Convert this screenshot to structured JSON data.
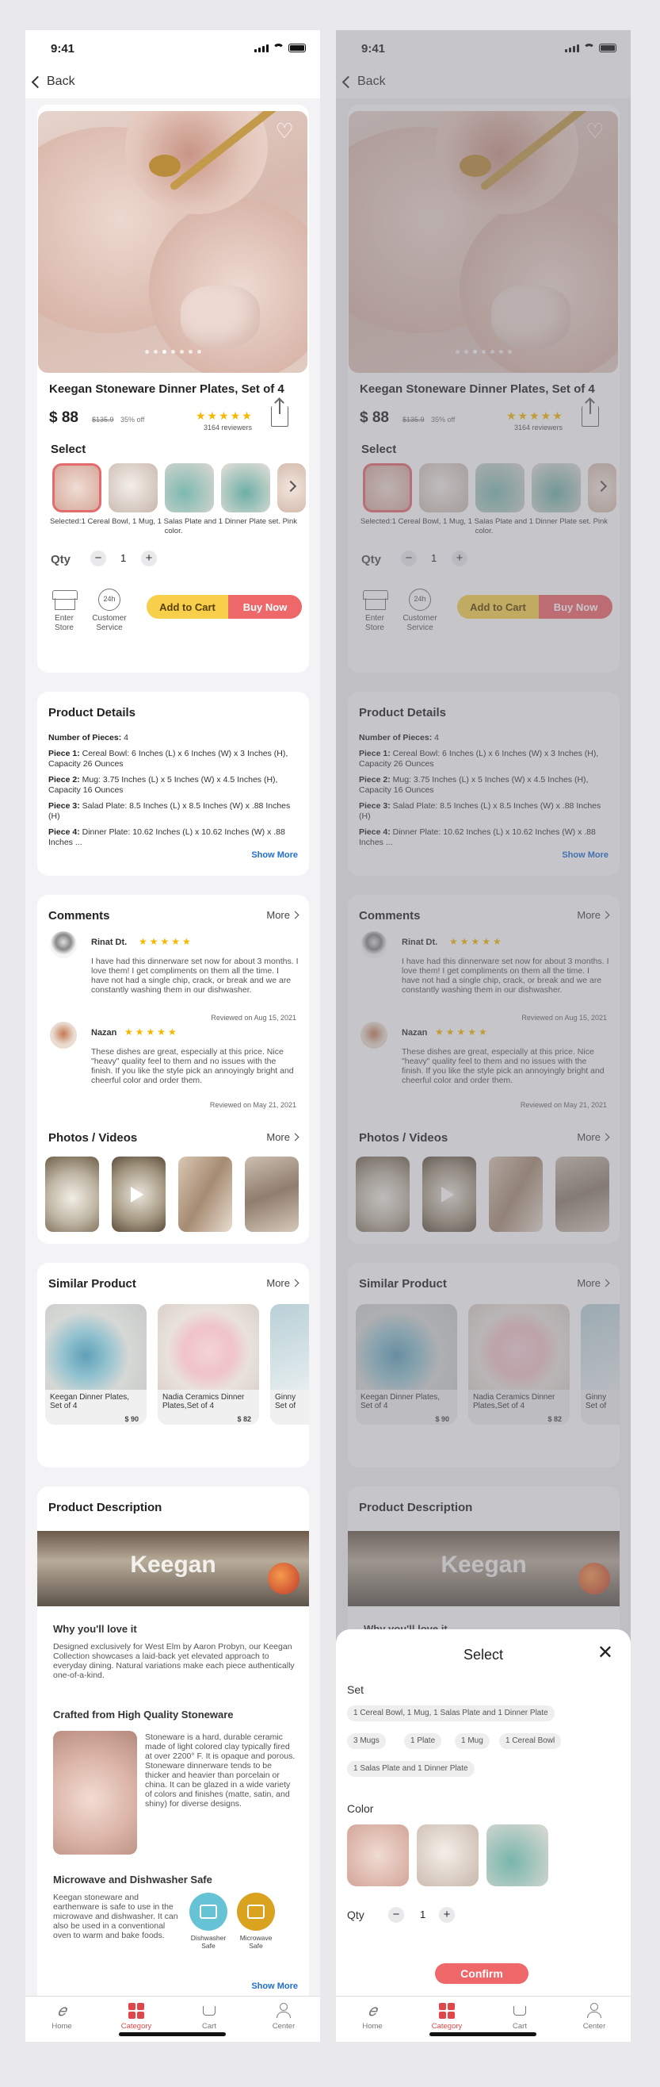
{
  "status": {
    "time": "9:41"
  },
  "nav": {
    "back_label": "Back"
  },
  "product": {
    "title": "Keegan Stoneware Dinner Plates, Set of 4",
    "price": "$ 88",
    "old_price": "$135.9",
    "discount": "35% off",
    "rating": 5,
    "stars": "★★★★★",
    "reviewers": "3164 reviewers",
    "select_label": "Select",
    "selected_note": "Selected:1 Cereal Bowl, 1 Mug, 1 Salas Plate and 1 Dinner Plate set. Pink color.",
    "qty_label": "Qty",
    "qty_value": "1",
    "minus": "−",
    "plus": "+",
    "enter_store": "Enter Store",
    "customer_service": "Customer Service",
    "service_icon_text": "24h",
    "add_to_cart": "Add to Cart",
    "buy_now": "Buy Now"
  },
  "details": {
    "title": "Product Details",
    "pieces_label": "Number of Pieces:",
    "pieces_value": " 4",
    "items": [
      {
        "label": "Piece 1:",
        "text": " Cereal Bowl: 6 Inches (L) x 6 Inches (W) x 3 Inches (H), Capacity 26 Ounces"
      },
      {
        "label": "Piece 2:",
        "text": " Mug: 3.75 Inches (L) x 5 Inches (W) x 4.5 Inches (H), Capacity 16 Ounces"
      },
      {
        "label": "Piece 3:",
        "text": "  Salad Plate: 8.5 Inches (L) x 8.5 Inches (W) x .88 Inches (H)"
      },
      {
        "label": "Piece 4:",
        "text": "  Dinner Plate: 10.62 Inches (L) x 10.62 Inches (W) x .88 Inches ..."
      }
    ],
    "show_more": "Show More"
  },
  "comments": {
    "title": "Comments",
    "more": "More",
    "items": [
      {
        "name": "Rinat Dt.",
        "stars": "★★★★★",
        "text": "I have had this dinnerware set now for about 3 months. I love them! I get compliments on them all the time. I have not had a single chip, crack, or break and we are constantly washing them in our dishwasher.",
        "date": "Reviewed on Aug 15, 2021"
      },
      {
        "name": "Nazan",
        "stars": "★★★★★",
        "text": "These dishes are great, especially at this price. Nice \"heavy\" quality feel to them and no issues with the finish. If you like the style pick an annoyingly bright and cheerful color and order them.",
        "date": "Reviewed on May 21, 2021"
      }
    ]
  },
  "media": {
    "title": "Photos / Videos",
    "more": "More"
  },
  "similar": {
    "title": "Similar Product",
    "more": "More",
    "items": [
      {
        "name": "Keegan Dinner Plates, Set of 4",
        "price": "$ 90"
      },
      {
        "name": "Nadia Ceramics Dinner Plates,Set of 4",
        "price": "$ 82"
      },
      {
        "name": "Ginny Set of",
        "price": ""
      }
    ]
  },
  "description": {
    "title": "Product Description",
    "banner_text": "Keegan",
    "why_title": "Why you'll love it",
    "why_text": "Designed exclusively for West Elm by Aaron Probyn, our Keegan Collection showcases a laid-back yet elevated approach to everyday dining. Natural variations make each piece authentically one-of-a-kind.",
    "crafted_title": "Crafted from High Quality Stoneware",
    "crafted_text": "Stoneware is a hard, durable ceramic made of light colored clay typically fired at over 2200° F. It is opaque and porous. Stoneware dinnerware tends to be thicker and heavier than porcelain or china. It can be glazed in a wide variety of colors and finishes (matte, satin, and shiny) for diverse designs.",
    "safe_title": "Microwave and Dishwasher Safe",
    "safe_text": "Keegan stoneware and earthenware is safe to use in the microwave and dishwasher. It can also be used in a conventional oven to warm and bake foods.",
    "dishwasher_label": "Dishwasher Safe",
    "microwave_label": "Microwave Safe",
    "show_more": "Show More",
    "colors": {
      "dishwasher": "#66c3d6",
      "microwave": "#d9a21f"
    }
  },
  "tabs": [
    {
      "label": "Home",
      "icon": "home-icon"
    },
    {
      "label": "Category",
      "icon": "category-icon"
    },
    {
      "label": "Cart",
      "icon": "cart-icon"
    },
    {
      "label": "Center",
      "icon": "user-icon"
    }
  ],
  "sheet": {
    "title": "Select",
    "close": "✕",
    "set_label": "Set",
    "sets": [
      "1 Cereal Bowl, 1 Mug, 1 Salas Plate and 1 Dinner Plate",
      "3 Mugs",
      "1 Plate",
      "1 Mug",
      "1 Cereal Bowl",
      "1 Salas Plate and 1 Dinner Plate"
    ],
    "color_label": "Color",
    "qty_label": "Qty",
    "qty_value": "1",
    "minus": "−",
    "plus": "+",
    "confirm": "Confirm"
  },
  "colors": {
    "accent": "#ee6769",
    "cart": "#f7cf4a",
    "link": "#1f6dd1",
    "star": "#f5b700"
  }
}
